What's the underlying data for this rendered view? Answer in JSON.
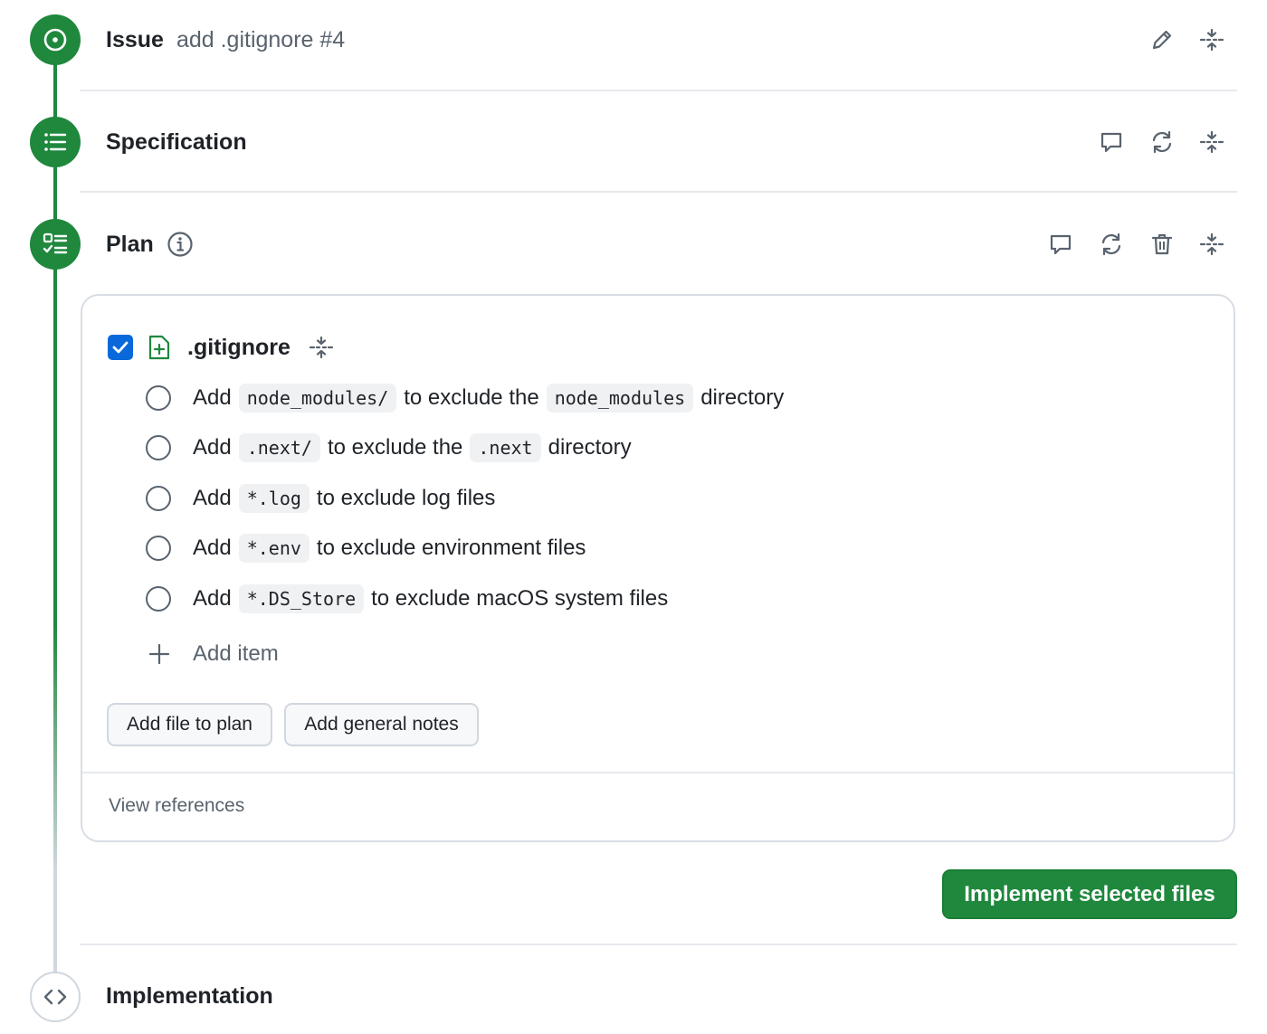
{
  "issue": {
    "label": "Issue",
    "title": "add .gitignore #4"
  },
  "specification": {
    "label": "Specification"
  },
  "plan": {
    "label": "Plan",
    "file": {
      "name": ".gitignore",
      "checked": true
    },
    "items": [
      {
        "p1": "Add",
        "c1": "node_modules/",
        "p2": "to exclude the",
        "c2": "node_modules",
        "p3": "directory"
      },
      {
        "p1": "Add",
        "c1": ".next/",
        "p2": "to exclude the",
        "c2": ".next",
        "p3": "directory"
      },
      {
        "p1": "Add",
        "c1": "*.log",
        "p2": "to exclude log files"
      },
      {
        "p1": "Add",
        "c1": "*.env",
        "p2": "to exclude environment files"
      },
      {
        "p1": "Add",
        "c1": "*.DS_Store",
        "p2": "to exclude macOS system files"
      }
    ],
    "add_item_label": "Add item",
    "add_file_label": "Add file to plan",
    "add_notes_label": "Add general notes",
    "view_refs_label": "View references"
  },
  "implement_label": "Implement selected files",
  "implementation": {
    "label": "Implementation"
  },
  "colors": {
    "accent": "#1f883d",
    "checkbox": "#0969da",
    "muted": "#59636e"
  },
  "icons": [
    "issue-opened-icon",
    "list-icon",
    "checklist-icon",
    "info-icon",
    "pencil-icon",
    "comment-icon",
    "sync-icon",
    "trash-icon",
    "fold-icon",
    "file-added-icon",
    "plus-icon",
    "code-icon",
    "check-icon"
  ]
}
